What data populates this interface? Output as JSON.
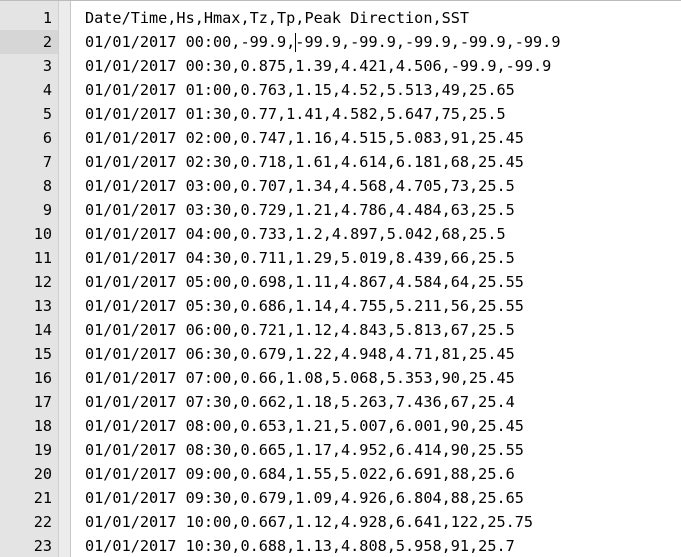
{
  "editor": {
    "current_line": 2,
    "lines": [
      {
        "n": "1",
        "text": "Date/Time,Hs,Hmax,Tz,Tp,Peak Direction,SST"
      },
      {
        "n": "2",
        "text": "01/01/2017 00:00,-99.9,-99.9,-99.9,-99.9,-99.9,-99.9"
      },
      {
        "n": "3",
        "text": "01/01/2017 00:30,0.875,1.39,4.421,4.506,-99.9,-99.9"
      },
      {
        "n": "4",
        "text": "01/01/2017 01:00,0.763,1.15,4.52,5.513,49,25.65"
      },
      {
        "n": "5",
        "text": "01/01/2017 01:30,0.77,1.41,4.582,5.647,75,25.5"
      },
      {
        "n": "6",
        "text": "01/01/2017 02:00,0.747,1.16,4.515,5.083,91,25.45"
      },
      {
        "n": "7",
        "text": "01/01/2017 02:30,0.718,1.61,4.614,6.181,68,25.45"
      },
      {
        "n": "8",
        "text": "01/01/2017 03:00,0.707,1.34,4.568,4.705,73,25.5"
      },
      {
        "n": "9",
        "text": "01/01/2017 03:30,0.729,1.21,4.786,4.484,63,25.5"
      },
      {
        "n": "10",
        "text": "01/01/2017 04:00,0.733,1.2,4.897,5.042,68,25.5"
      },
      {
        "n": "11",
        "text": "01/01/2017 04:30,0.711,1.29,5.019,8.439,66,25.5"
      },
      {
        "n": "12",
        "text": "01/01/2017 05:00,0.698,1.11,4.867,4.584,64,25.55"
      },
      {
        "n": "13",
        "text": "01/01/2017 05:30,0.686,1.14,4.755,5.211,56,25.55"
      },
      {
        "n": "14",
        "text": "01/01/2017 06:00,0.721,1.12,4.843,5.813,67,25.5"
      },
      {
        "n": "15",
        "text": "01/01/2017 06:30,0.679,1.22,4.948,4.71,81,25.45"
      },
      {
        "n": "16",
        "text": "01/01/2017 07:00,0.66,1.08,5.068,5.353,90,25.45"
      },
      {
        "n": "17",
        "text": "01/01/2017 07:30,0.662,1.18,5.263,7.436,67,25.4"
      },
      {
        "n": "18",
        "text": "01/01/2017 08:00,0.653,1.21,5.007,6.001,90,25.45"
      },
      {
        "n": "19",
        "text": "01/01/2017 08:30,0.665,1.17,4.952,6.414,90,25.55"
      },
      {
        "n": "20",
        "text": "01/01/2017 09:00,0.684,1.55,5.022,6.691,88,25.6"
      },
      {
        "n": "21",
        "text": "01/01/2017 09:30,0.679,1.09,4.926,6.804,88,25.65"
      },
      {
        "n": "22",
        "text": "01/01/2017 10:00,0.667,1.12,4.928,6.641,122,25.75"
      },
      {
        "n": "23",
        "text": "01/01/2017 10:30,0.688,1.13,4.808,5.958,91,25.7"
      }
    ]
  }
}
